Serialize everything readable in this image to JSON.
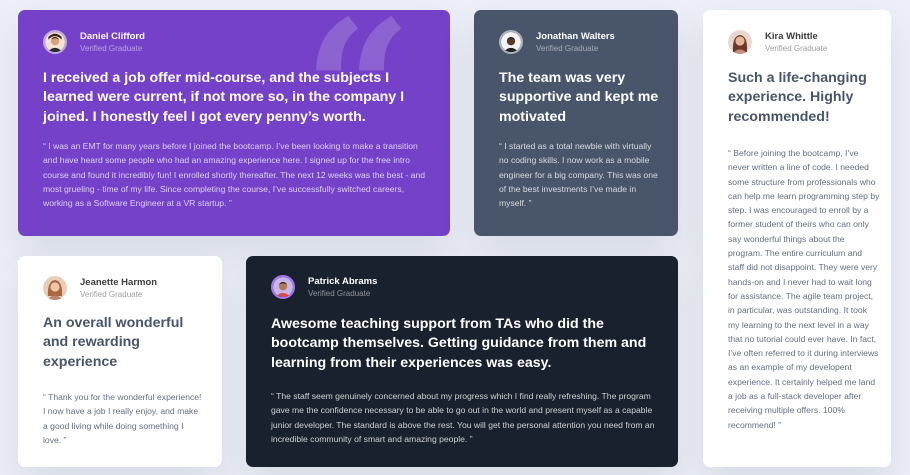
{
  "colors": {
    "page_bg": "#eceff7",
    "purple": "#7541c8",
    "grayish_blue": "#48556a",
    "very_dark_blue": "#19212e",
    "white": "#ffffff"
  },
  "testimonials": [
    {
      "name": "Daniel Clifford",
      "role": "Verified Graduate",
      "headline": "I received a job offer mid-course, and the subjects I learned were current, if not more so, in the company I joined. I honestly feel I got every penny’s worth.",
      "body": "“ I was an EMT for many years before I joined the bootcamp. I’ve been looking to make a transition and have heard some people who had an amazing experience here. I signed up for the free intro course and found it incredibly fun! I enrolled shortly thereafter. The next 12 weeks was the best - and most grueling - time of my life. Since completing the course, I’ve successfully switched careers, working as a Software Engineer at a VR startup. ”",
      "quote_icon": "quotation-mark-icon"
    },
    {
      "name": "Jonathan Walters",
      "role": "Verified Graduate",
      "headline": "The team was very supportive and kept me motivated",
      "body": "“ I started as a total newbie with virtually no coding skills. I now work as a mobile engineer for a big company. This was one of the best investments I’ve made in myself. ”"
    },
    {
      "name": "Kira Whittle",
      "role": "Verified Graduate",
      "headline": "Such a life-changing experience. Highly recommended!",
      "body": "“ Before joining the bootcamp, I’ve never written a line of code. I needed some structure from professionals who can help me learn programming step by step. I was encouraged to enroll by a former student of theirs who can only say wonderful things about the program. The entire curriculum and staff did not disappoint. They were very hands-on and I never had to wait long for assistance. The agile team project, in particular, was outstanding. It took my learning to the next level in a way that no tutorial could ever have. In fact, I’ve often referred to it during interviews as an example of my developent experience. It certainly helped me land a job as a full-stack developer after receiving multiple offers. 100% recommend! ”"
    },
    {
      "name": "Jeanette Harmon",
      "role": "Verified Graduate",
      "headline": "An overall wonderful and rewarding experience",
      "body": "“ Thank you for the wonderful experience! I now have a job I really enjoy, and make a good living while doing something I love. ”"
    },
    {
      "name": "Patrick Abrams",
      "role": "Verified Graduate",
      "headline": "Awesome teaching support from TAs who did the bootcamp themselves. Getting guidance from them and learning from their experiences was easy.",
      "body": "“ The staff seem genuinely concerned about my progress which I find really refreshing. The program gave me the confidence necessary to be able to go out in the world and present myself as a capable junior developer. The standard is above the rest. You will get the personal attention you need from an incredible community of smart and amazing people. ”"
    }
  ]
}
